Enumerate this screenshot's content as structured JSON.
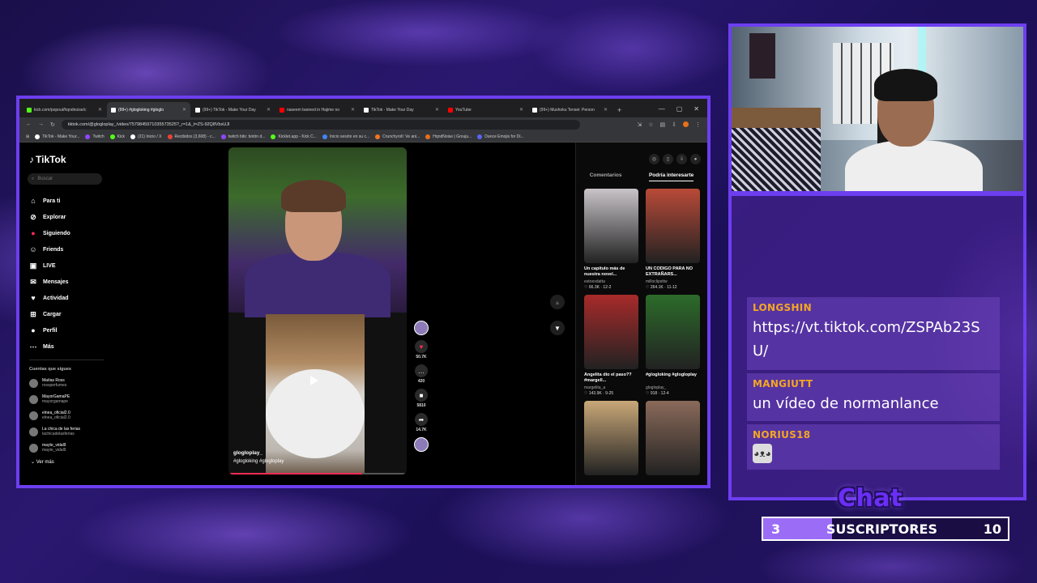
{
  "browser": {
    "tabs": [
      {
        "title": "kick.com/popout/hqndnoise/c",
        "color": "#53fc18",
        "active": false
      },
      {
        "title": "(99+) #glogloking #gloglo",
        "color": "#ffffff",
        "active": true
      },
      {
        "title": "(99+) TikTok - Make Your Day",
        "color": "#ffffff",
        "active": false
      },
      {
        "title": "naseem banned in Hajime no",
        "color": "#ff0000",
        "active": false
      },
      {
        "title": "TikTok - Make Your Day",
        "color": "#ffffff",
        "active": false
      },
      {
        "title": "YouTube",
        "color": "#ff0000",
        "active": false
      },
      {
        "title": "(99+) Mushoku Tensei: Person",
        "color": "#ffffff",
        "active": false
      }
    ],
    "url": "tiktok.com/@glogloplay_/video/7579845971035573525?_r=1&_t=ZS-92Q8VbsUJl",
    "bookmarks": [
      {
        "label": "TikTok - Make Your...",
        "color": "#ffffff"
      },
      {
        "label": "Twitch",
        "color": "#9146ff"
      },
      {
        "label": "Kick",
        "color": "#53fc18"
      },
      {
        "label": "(21) Inicio / X",
        "color": "#ffffff"
      },
      {
        "label": "Recibidos (3,608) - c...",
        "color": "#ea4335"
      },
      {
        "label": "twitch bits: botón d...",
        "color": "#9146ff"
      },
      {
        "label": "Kicklet.app - Kick C...",
        "color": "#53fc18"
      },
      {
        "label": "Inicio sesión en su c...",
        "color": "#4285f4"
      },
      {
        "label": "Crunchyroll: Ve ani...",
        "color": "#f47521"
      },
      {
        "label": "HqndNoise | Grouju...",
        "color": "#e8711a"
      },
      {
        "label": "Dance Emojis for Di...",
        "color": "#5865f2"
      }
    ]
  },
  "tiktok": {
    "logo": "TikTok",
    "search_placeholder": "Buscar",
    "nav": [
      {
        "label": "Para ti",
        "icon": "home-icon",
        "glyph": "⌂",
        "red": false
      },
      {
        "label": "Explorar",
        "icon": "compass-icon",
        "glyph": "⊘",
        "red": false
      },
      {
        "label": "Siguiendo",
        "icon": "following-icon",
        "glyph": "●",
        "red": true
      },
      {
        "label": "Friends",
        "icon": "friends-icon",
        "glyph": "☺",
        "red": false
      },
      {
        "label": "LIVE",
        "icon": "live-icon",
        "glyph": "▣",
        "red": false
      },
      {
        "label": "Mensajes",
        "icon": "messages-icon",
        "glyph": "✉",
        "red": false
      },
      {
        "label": "Actividad",
        "icon": "activity-icon",
        "glyph": "♥",
        "red": false
      },
      {
        "label": "Cargar",
        "icon": "upload-icon",
        "glyph": "⊞",
        "red": false
      },
      {
        "label": "Perfil",
        "icon": "profile-icon",
        "glyph": "●",
        "red": false
      },
      {
        "label": "Más",
        "icon": "more-icon",
        "glyph": "⋯",
        "red": false
      }
    ],
    "following_title": "Cuentas que sigues",
    "following": [
      {
        "name": "Matías Ross",
        "handle": "rossperfumes"
      },
      {
        "name": "MayorGamaPE",
        "handle": "mayorgamape"
      },
      {
        "name": "elnea_oficial2.0",
        "handle": "elnea_oficial2.0"
      },
      {
        "name": "La chica de las ferias",
        "handle": "lachicadelasferias"
      },
      {
        "name": "mayte_vidal9",
        "handle": "mayte_vidal9"
      }
    ],
    "see_more": "Ver más",
    "video": {
      "author": "glogloplay_",
      "tags": "#glogloking #glogloplay",
      "progress_fraction": 0.75
    },
    "actions": [
      {
        "name": "like-button",
        "glyph": "♥",
        "count": "50.7K",
        "heart": true
      },
      {
        "name": "comment-button",
        "glyph": "…",
        "count": "420",
        "heart": false
      },
      {
        "name": "save-button",
        "glyph": "■",
        "count": "5810",
        "heart": false
      },
      {
        "name": "share-button",
        "glyph": "➦",
        "count": "14.7K",
        "heart": false
      }
    ],
    "right_tabs": {
      "comments": "Comentarios",
      "interesting": "Podría interesarte"
    },
    "recommendations": [
      {
        "title": "Un capitulo más de nuestra novel...",
        "author": "estoesdatta",
        "stats": "♡ 66.3K · 12-2",
        "color": "#c9c4c8"
      },
      {
        "title": "UN CÓDIGO PARA NO EXTRAÑARS...",
        "author": "milloclipsttw",
        "stats": "♡ 264.1K · 11-12",
        "color": "#b94a38"
      },
      {
        "title": "Angelita dio el paso?? #margell...",
        "author": "margelita_a",
        "stats": "♡ 143.9K · 9-25",
        "color": "#a82a2a"
      },
      {
        "title": "#glogloking #glogloplay",
        "author": "glogloplay_",
        "stats": "♡ 918 · 12-4",
        "color": "#2c6b2a"
      },
      {
        "title": "",
        "author": "",
        "stats": "",
        "color": "#c9a878"
      },
      {
        "title": "",
        "author": "",
        "stats": "",
        "color": "#8a6a5a"
      }
    ]
  },
  "chat": {
    "messages": [
      {
        "user": "LONGSHIN",
        "text": "https://vt.tiktok.com/ZSPAb23SU/"
      },
      {
        "user": "MANGIUTT",
        "text": "un vídeo de normanlance"
      },
      {
        "user": "NORIUS18",
        "text": ""
      }
    ],
    "title": "Chat",
    "user_color": "#f5a623"
  },
  "subs": {
    "current": "3",
    "label": "SUSCRIPTORES",
    "goal": "10",
    "fill_fraction": 0.28
  }
}
